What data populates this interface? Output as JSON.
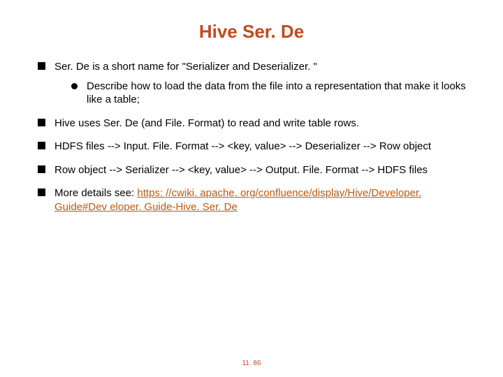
{
  "title": "Hive Ser. De",
  "bullets": {
    "b1": "Ser. De is a short name for \"Serializer and Deserializer. \"",
    "b1_sub1": "Describe how to load the data from the file into a representation that make it looks like a table;",
    "b2": "Hive uses Ser. De (and File. Format) to read and write table rows.",
    "b3": "HDFS files --> Input. File. Format --> <key, value> --> Deserializer --> Row object",
    "b4": "Row object --> Serializer --> <key, value> --> Output. File. Format --> HDFS files",
    "b5_prefix": "More details see: ",
    "b5_link": "https: //cwiki. apache. org/confluence/display/Hive/Developer. Guide#Dev eloper. Guide-Hive. Ser. De"
  },
  "page_number": "11. 86"
}
